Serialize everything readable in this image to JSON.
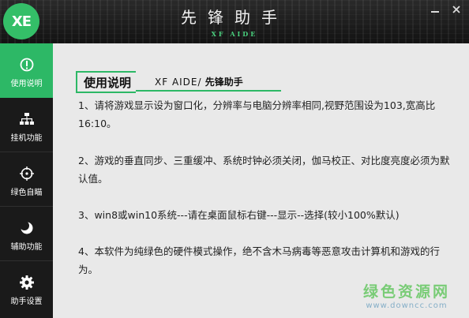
{
  "window": {
    "logo_text": "XE",
    "title": "先锋助手",
    "subtitle": "XF AIDE",
    "minimize_icon": "minimize-icon",
    "close_icon": "close-icon"
  },
  "sidebar": {
    "items": [
      {
        "label": "使用说明",
        "icon": "info-icon",
        "active": true
      },
      {
        "label": "挂机功能",
        "icon": "hierarchy-icon",
        "active": false
      },
      {
        "label": "绿色自瞄",
        "icon": "crosshair-icon",
        "active": false
      },
      {
        "label": "辅助功能",
        "icon": "moon-icon",
        "active": false
      },
      {
        "label": "助手设置",
        "icon": "gear-icon",
        "active": false
      }
    ]
  },
  "main": {
    "heading": "使用说明",
    "heading_sub_latin": "XF AIDE/",
    "heading_sub_cn": "先锋助手",
    "paragraphs": [
      "1、请将游戏显示设为窗口化，分辨率与电脑分辨率相同,视野范围设为103,宽高比16:10。",
      "2、游戏的垂直同步、三重缓冲、系统时钟必须关闭，伽马校正、对比度亮度必须为默认值。",
      "3、win8或win10系统---请在桌面鼠标右键---显示--选择(较小100%默认)",
      "4、本软件为纯绿色的硬件模式操作，绝不含木马病毒等恶意攻击计算机和游戏的行为。"
    ]
  },
  "watermark": {
    "name": "绿色资源网",
    "url": "www.downcc.com"
  },
  "colors": {
    "accent": "#2db866",
    "sidebar_bg": "#1a1a1a",
    "content_bg": "#e9e9e9"
  }
}
